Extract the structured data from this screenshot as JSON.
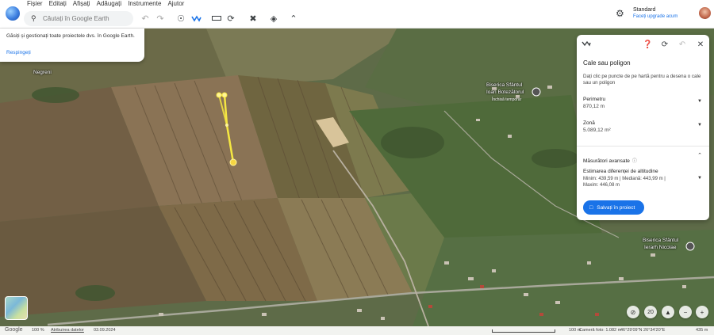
{
  "menu": [
    "Fișier",
    "Editați",
    "Afișați",
    "Adăugați",
    "Instrumente",
    "Ajutor"
  ],
  "search": {
    "placeholder": "Căutați în Google Earth"
  },
  "account": {
    "plan": "Standard",
    "upgrade": "Faceți upgrade acum"
  },
  "notification": {
    "text": "Găsiți și gestionați toate proiectele dvs. în Google Earth.",
    "dismiss": "Respingeți"
  },
  "panel": {
    "title": "Cale sau poligon",
    "description": "Dați clic pe puncte de pe hartă pentru a desena o cale sau un poligon",
    "perimeter": {
      "label": "Perimetru",
      "value": "870,12 m"
    },
    "area": {
      "label": "Zonă",
      "value": "5.089,12 m²"
    },
    "advanced": {
      "label": "Măsurători avansate"
    },
    "elevation": {
      "label": "Estimarea diferenței de altitudine",
      "values_line1": "Minim: 439,59 m | Mediană: 443,99 m |",
      "values_line2": "Maxim: 446,08 m"
    },
    "save_label": "Salvați în proiect"
  },
  "map_labels": {
    "village": "Negreni",
    "church1_line1": "Biserica Sfântul",
    "church1_line2": "Ioan Botezătorul",
    "church1_status": "Închisă temporar",
    "church2_line1": "Biserica Sfântul",
    "church2_line2": "Ierarh Nicolae"
  },
  "statusbar": {
    "brand": "Google",
    "zoom": "100 %",
    "attribution": "Atribuirea datelor",
    "date": "03.09.2024",
    "scale": "100 m",
    "camera": "Cameră foto: 1.082 m",
    "coords": "46°29'09\"N 26°34'20\"E",
    "elevation": "435 m"
  },
  "map_controls": {
    "tilt": "20"
  },
  "colors": {
    "accent": "#1a73e8",
    "measure_line": "#f5e642"
  },
  "icons": {
    "search": "search-icon",
    "undo": "undo-icon",
    "redo": "redo-icon",
    "pin": "pin-icon",
    "path": "path-icon",
    "ruler": "ruler-icon",
    "history": "history-icon",
    "voyager": "voyager-icon",
    "layers": "layers-icon",
    "collapse": "chevron-up-icon",
    "settings": "gear-icon"
  }
}
